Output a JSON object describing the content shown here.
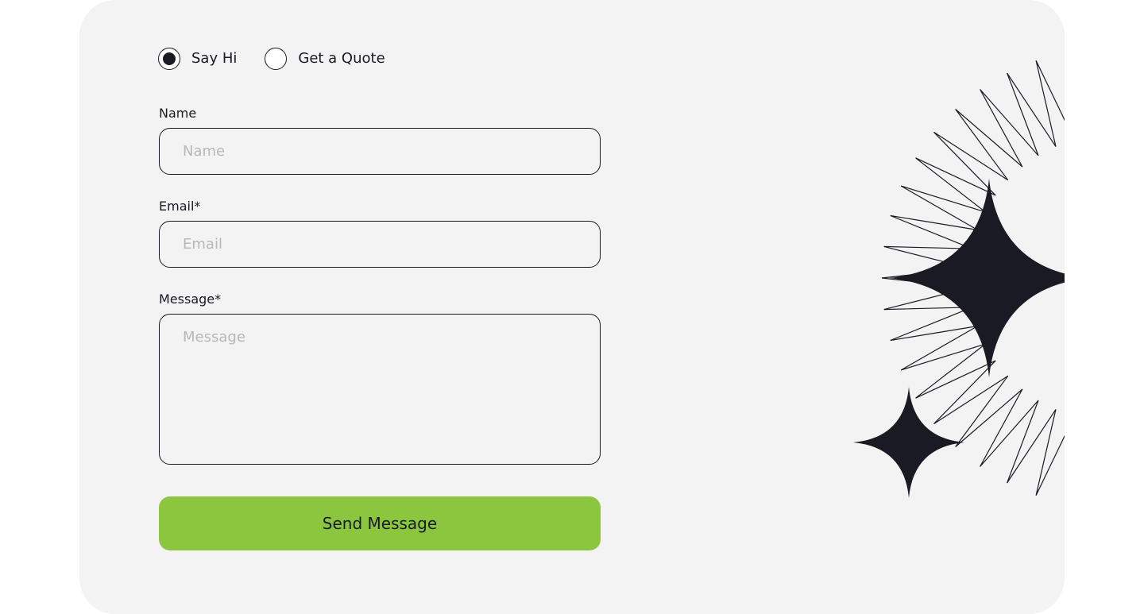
{
  "form": {
    "type_options": [
      {
        "label": "Say Hi",
        "selected": true
      },
      {
        "label": "Get a Quote",
        "selected": false
      }
    ],
    "name": {
      "label": "Name",
      "placeholder": "Name",
      "value": ""
    },
    "email": {
      "label": "Email*",
      "placeholder": "Email",
      "value": ""
    },
    "message": {
      "label": "Message*",
      "placeholder": "Message",
      "value": ""
    },
    "submit_label": "Send Message"
  },
  "colors": {
    "card_background": "#f3f3f3",
    "accent_green": "#8bc63e",
    "dark": "#191a23"
  },
  "decoration": {
    "icons": [
      "starburst-illustration",
      "large-star-icon",
      "small-star-icon"
    ]
  }
}
